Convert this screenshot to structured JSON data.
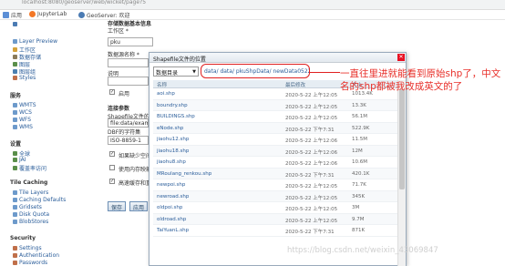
{
  "browser": {
    "url": "localhost:8080/geoserver/web/wicket/page?5"
  },
  "bookmarks": [
    {
      "label": "应用",
      "color": "#5c8fd6"
    },
    {
      "label": "JupyterLab",
      "color": "#f37726"
    },
    {
      "label": "GeoServer: 欢迎",
      "color": "#4b7bb3"
    }
  ],
  "sidebar": {
    "items_top": [
      {
        "label": "Layer Preview",
        "color": "#6d9acb"
      },
      {
        "label": "工作区",
        "color": "#d4a23a"
      },
      {
        "label": "数据存储",
        "color": "#8a7b5a"
      },
      {
        "label": "图层",
        "color": "#5a8f4a"
      },
      {
        "label": "图层组",
        "color": "#4a7fb0"
      },
      {
        "label": "Styles",
        "color": "#c0704a"
      }
    ],
    "services_title": "服务",
    "services": [
      {
        "label": "WMTS",
        "color": "#6d9acb"
      },
      {
        "label": "WCS",
        "color": "#6d9acb"
      },
      {
        "label": "WFS",
        "color": "#6d9acb"
      },
      {
        "label": "WMS",
        "color": "#6d9acb"
      }
    ],
    "settings_title": "设置",
    "settings": [
      {
        "label": "全球",
        "color": "#5a8f4a"
      },
      {
        "label": "JAI",
        "color": "#5a8f4a"
      },
      {
        "label": "覆盖率访问",
        "color": "#5a8f4a"
      }
    ],
    "tile_title": "Tile Caching",
    "tile": [
      {
        "label": "Tile Layers",
        "color": "#6d9acb"
      },
      {
        "label": "Caching Defaults",
        "color": "#6d9acb"
      },
      {
        "label": "Gridsets",
        "color": "#6d9acb"
      },
      {
        "label": "Disk Quota",
        "color": "#6d9acb"
      },
      {
        "label": "BlobStores",
        "color": "#6d9acb"
      }
    ],
    "security_title": "Security",
    "security": [
      {
        "label": "Settings",
        "color": "#c0704a"
      },
      {
        "label": "Authentication",
        "color": "#c0704a"
      },
      {
        "label": "Passwords",
        "color": "#c0704a"
      }
    ]
  },
  "form": {
    "heading": "存储数据基本信息",
    "workspace_label": "工作区 *",
    "workspace_value": "pku",
    "datasource_label": "数据源名称 *",
    "description_label": "说明",
    "enabled_label": "启用",
    "connection_label": "连接参数",
    "shapefile_label": "Shapefile文件的位置",
    "shapefile_value": "file:data/example",
    "charset_label": "DBF的字符集",
    "charset_value": "ISO-8859-1",
    "check1_label": "如果缺少空间",
    "check2_label": "使用内存映射",
    "check3_label": "高速缓存和重",
    "save_label": "保存",
    "apply_label": "应用"
  },
  "dialog": {
    "title": "Shapefile文件的位置",
    "close": "✕",
    "dir_select": "数据目录",
    "path": "data/ data/ pkuShpData/ newData0522/",
    "columns": {
      "name": "名称",
      "modified": "最后修改",
      "size": "大小"
    },
    "files": [
      {
        "name": "aoi.shp",
        "modified": "2020-5-22 上午12:05",
        "size": "1013.4K"
      },
      {
        "name": "boundry.shp",
        "modified": "2020-5-22 上午12:05",
        "size": "13.3K"
      },
      {
        "name": "BUILDINGS.shp",
        "modified": "2020-5-22 上午12:05",
        "size": "56.1M"
      },
      {
        "name": "eNode.shp",
        "modified": "2020-5-22 下午7:31",
        "size": "522.9K"
      },
      {
        "name": "jiaohu12.shp",
        "modified": "2020-5-22 上午12:06",
        "size": "11.5M"
      },
      {
        "name": "jiaohu18.shp",
        "modified": "2020-5-22 上午12:06",
        "size": "12M"
      },
      {
        "name": "jiaohu8.shp",
        "modified": "2020-5-22 上午12:06",
        "size": "10.6M"
      },
      {
        "name": "MRoulang_renkou.shp",
        "modified": "2020-5-22 下午7:31",
        "size": "420.1K"
      },
      {
        "name": "newpoi.shp",
        "modified": "2020-5-22 上午12:05",
        "size": "71.7K"
      },
      {
        "name": "newroad.shp",
        "modified": "2020-5-22 上午12:05",
        "size": "345K"
      },
      {
        "name": "oldpoi.shp",
        "modified": "2020-5-22 上午12:05",
        "size": "3M"
      },
      {
        "name": "oldroad.shp",
        "modified": "2020-5-22 上午12:05",
        "size": "9.7M"
      },
      {
        "name": "TaiYuanL.shp",
        "modified": "2020-5-22 下午7:31",
        "size": "871K"
      }
    ]
  },
  "annotation": {
    "text": "一直往里进就能看到原始shp了，中文名的shp都被我改成英文的了",
    "color": "#e8302a"
  },
  "watermark": "https://blog.csdn.net/weixin_43069847"
}
